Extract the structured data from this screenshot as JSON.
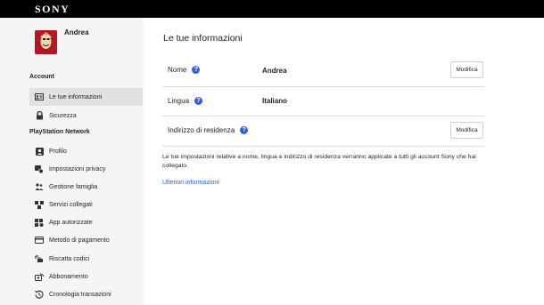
{
  "header": {
    "brand": "SONY"
  },
  "user": {
    "name": "Andrea"
  },
  "sidebar": {
    "sections": {
      "account": "Account",
      "psn": "PlayStation Network"
    },
    "items": [
      {
        "label": "Le tue informazioni",
        "icon": "id-card-icon",
        "active": true
      },
      {
        "label": "Sicurezza",
        "icon": "lock-icon"
      },
      {
        "label": "Profilo",
        "icon": "profile-icon"
      },
      {
        "label": "Impostazioni privacy",
        "icon": "privacy-icon"
      },
      {
        "label": "Gestione famiglia",
        "icon": "family-icon"
      },
      {
        "label": "Servizi collegati",
        "icon": "linked-services-icon"
      },
      {
        "label": "App autorizzate",
        "icon": "authorized-apps-icon"
      },
      {
        "label": "Metodo di pagamento",
        "icon": "credit-card-icon"
      },
      {
        "label": "Riscatta codici",
        "icon": "redeem-code-icon"
      },
      {
        "label": "Abbonamento",
        "icon": "subscription-icon"
      },
      {
        "label": "Cronologia transazioni",
        "icon": "history-icon"
      }
    ]
  },
  "main": {
    "title": "Le tue informazioni",
    "rows": [
      {
        "label": "Nome",
        "value": "Andrea",
        "button": "Modifica"
      },
      {
        "label": "Lingua",
        "value": "Italiano"
      },
      {
        "label": "Indirizzo di residenza",
        "value": "",
        "button": "Modifica"
      }
    ],
    "note": "Le tue impostazioni relative a nome, lingua e indirizzo di residenza verranno applicate a tutti gli account Sony che hai collegato.",
    "more_link": "Ulteriori informazioni"
  },
  "colors": {
    "accent": "#2f5fe0",
    "header_bg": "#000000",
    "sidebar_bg": "#f5f5f5",
    "active_item_bg": "#e2e2e2",
    "avatar_bg": "#b5161f"
  }
}
